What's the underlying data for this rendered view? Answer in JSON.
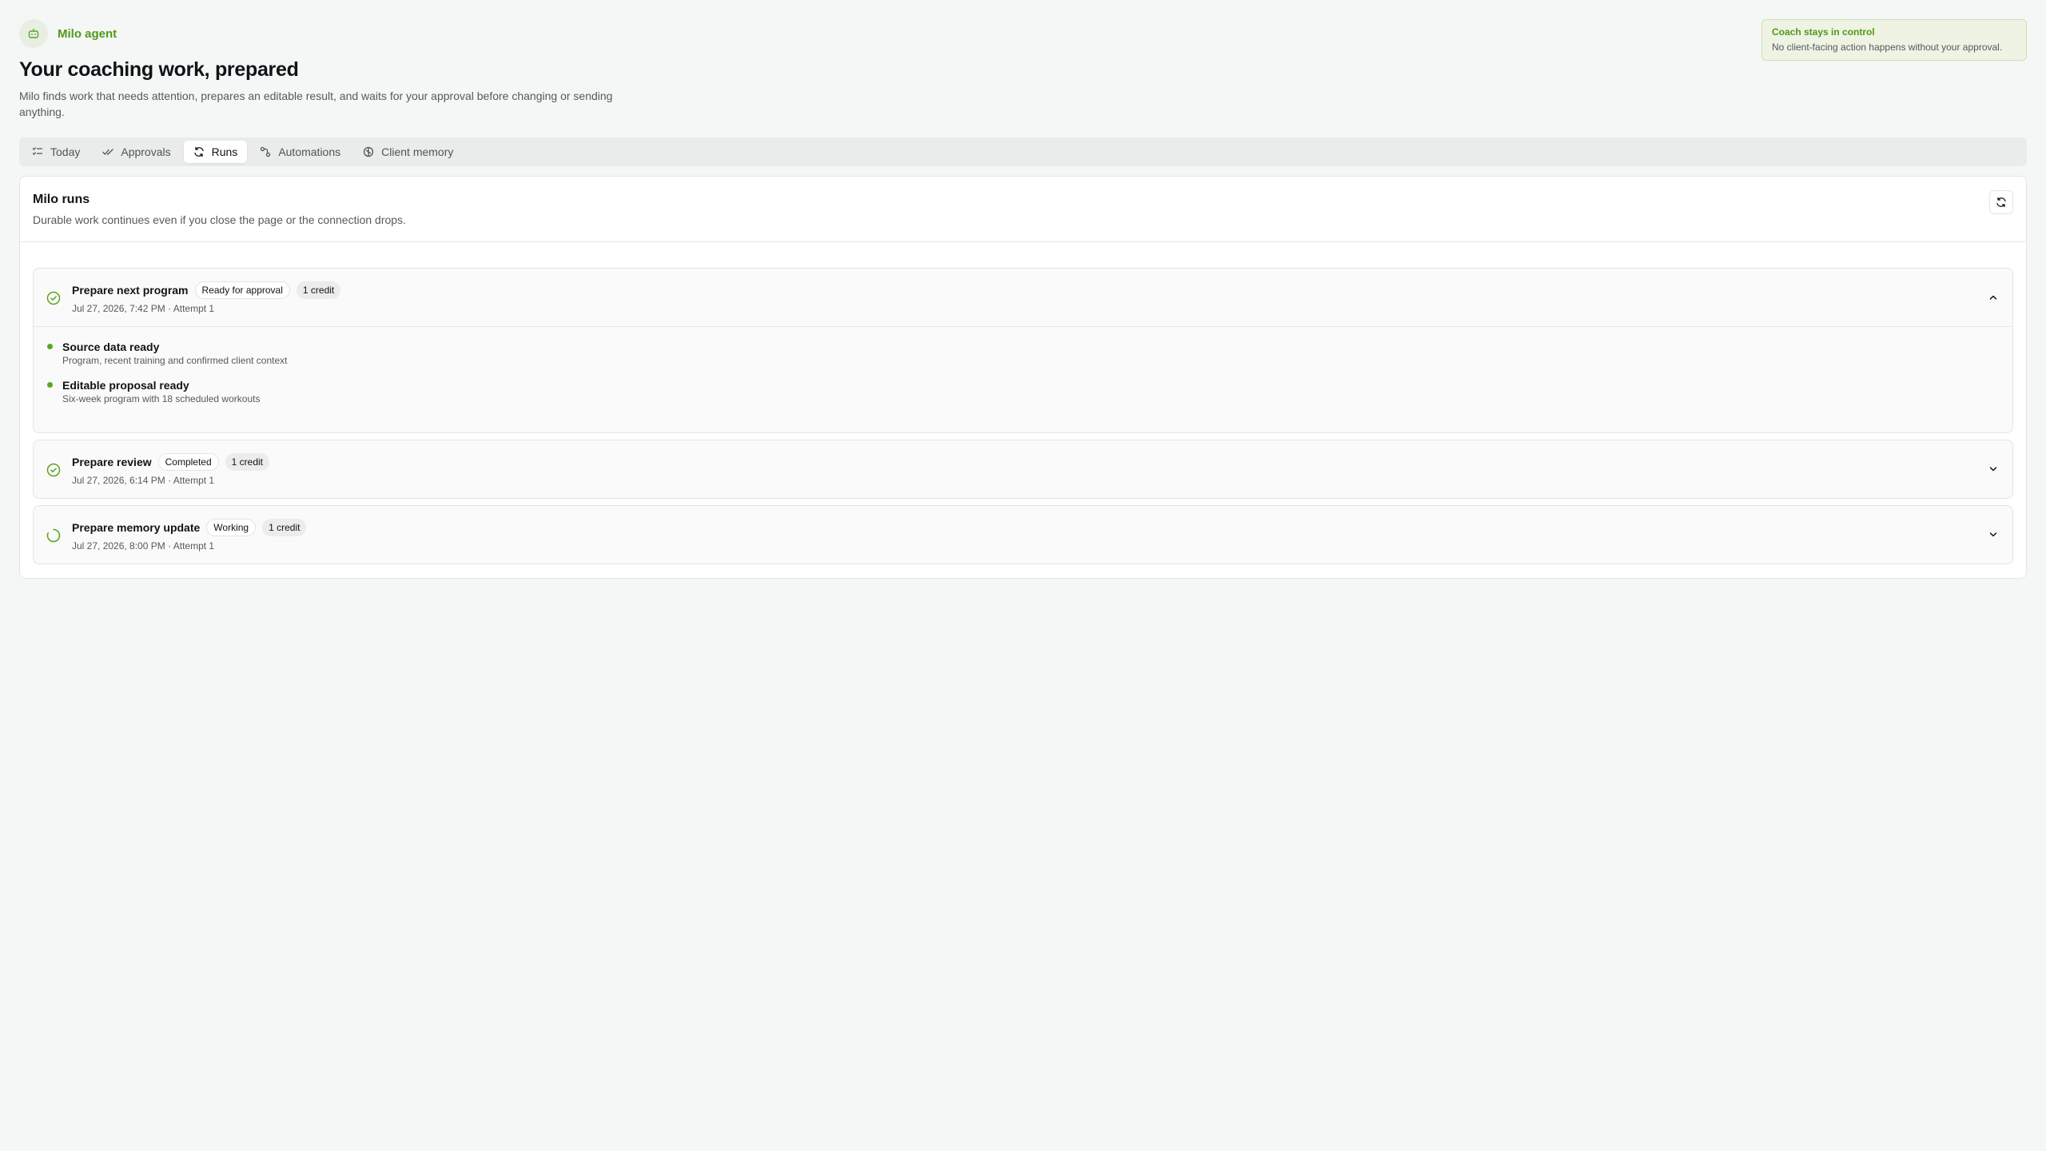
{
  "agent": {
    "label": "Milo agent",
    "icon": "robot-icon"
  },
  "header": {
    "title": "Your coaching work, prepared",
    "subtitle": "Milo finds work that needs attention, prepares an editable result, and waits for your approval before changing or sending anything."
  },
  "notice": {
    "title": "Coach stays in control",
    "text": "No client-facing action happens without your approval."
  },
  "tabs": [
    {
      "label": "Today",
      "icon": "checklist-icon",
      "active": false
    },
    {
      "label": "Approvals",
      "icon": "double-check-icon",
      "active": false
    },
    {
      "label": "Runs",
      "icon": "refresh-icon",
      "active": true
    },
    {
      "label": "Automations",
      "icon": "workflow-icon",
      "active": false
    },
    {
      "label": "Client memory",
      "icon": "brain-icon",
      "active": false
    }
  ],
  "panel": {
    "title": "Milo runs",
    "subtitle": "Durable work continues even if you close the page or the connection drops."
  },
  "runs": [
    {
      "name": "Prepare next program",
      "status": "Ready for approval",
      "credits": "1 credit",
      "meta": "Jul 27, 2026, 7:42 PM · Attempt 1",
      "expanded": true,
      "steps": [
        {
          "title": "Source data ready",
          "desc": "Program, recent training and confirmed client context"
        },
        {
          "title": "Editable proposal ready",
          "desc": "Six-week program with 18 scheduled workouts"
        }
      ]
    },
    {
      "name": "Prepare review",
      "status": "Completed",
      "credits": "1 credit",
      "meta": "Jul 27, 2026, 6:14 PM · Attempt 1",
      "expanded": false
    },
    {
      "name": "Prepare memory update",
      "status": "Working",
      "credits": "1 credit",
      "meta": "Jul 27, 2026, 8:00 PM · Attempt 1",
      "expanded": false
    }
  ],
  "colors": {
    "accent": "#5aa61f",
    "accent_text": "#4f9a1a",
    "notice_bg": "#eef3e3"
  }
}
